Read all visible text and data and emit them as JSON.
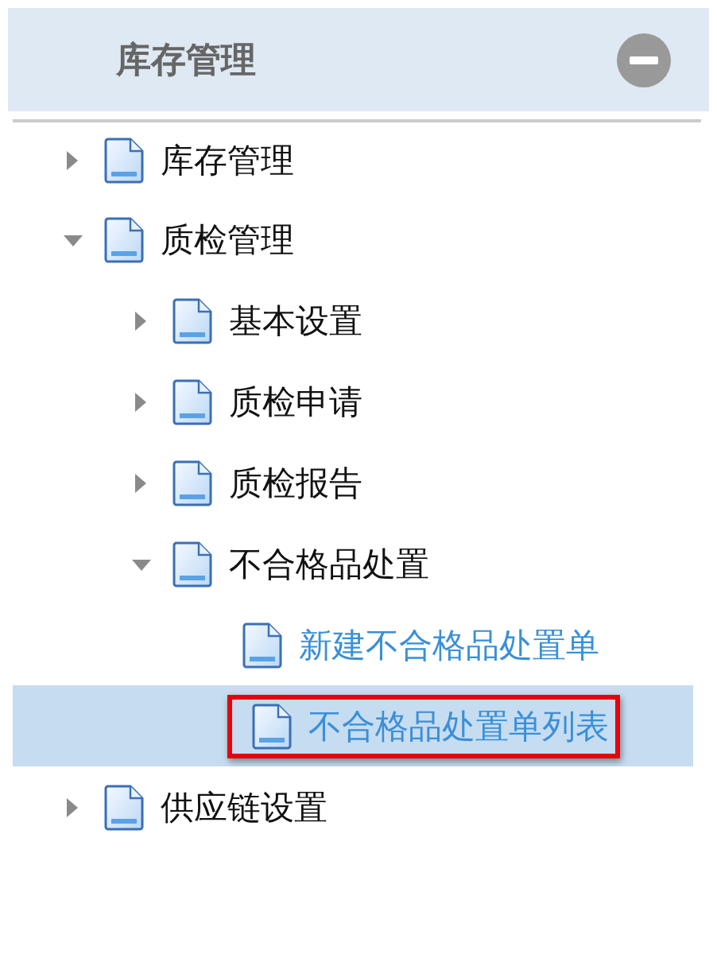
{
  "panel": {
    "title": "库存管理",
    "collapsed": false
  },
  "tree": [
    {
      "label": "库存管理",
      "expanded": false
    },
    {
      "label": "质检管理",
      "expanded": true,
      "children": [
        {
          "label": "基本设置",
          "expanded": false
        },
        {
          "label": "质检申请",
          "expanded": false
        },
        {
          "label": "质检报告",
          "expanded": false
        },
        {
          "label": "不合格品处置",
          "expanded": true,
          "children": [
            {
              "label": "新建不合格品处置单",
              "kind": "link",
              "selected": false,
              "annotated": false
            },
            {
              "label": "不合格品处置单列表",
              "kind": "link",
              "selected": true,
              "annotated": true
            }
          ]
        }
      ]
    },
    {
      "label": "供应链设置",
      "expanded": false
    }
  ]
}
